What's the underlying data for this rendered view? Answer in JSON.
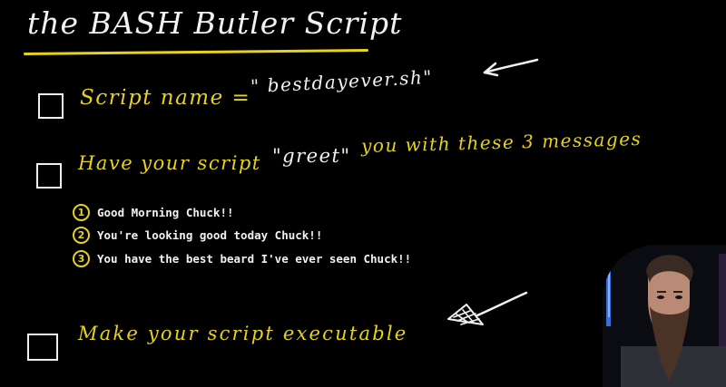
{
  "title": "the BASH Butler Script",
  "tasks": [
    {
      "label": "Script name =",
      "value": "\" bestdayever.sh\""
    },
    {
      "label": "Have your script",
      "value": "\"greet\"",
      "suffix": "you with these 3 messages"
    },
    {
      "label": "Make your script executable"
    }
  ],
  "messages": [
    {
      "number": "1",
      "text": "Good Morning Chuck!!"
    },
    {
      "number": "2",
      "text": "You're looking good today Chuck!!"
    },
    {
      "number": "3",
      "text": "You have the best beard I've ever seen Chuck!!"
    }
  ],
  "colors": {
    "background": "#000000",
    "accent": "#e6d21e",
    "ink": "#f2f2f2"
  }
}
